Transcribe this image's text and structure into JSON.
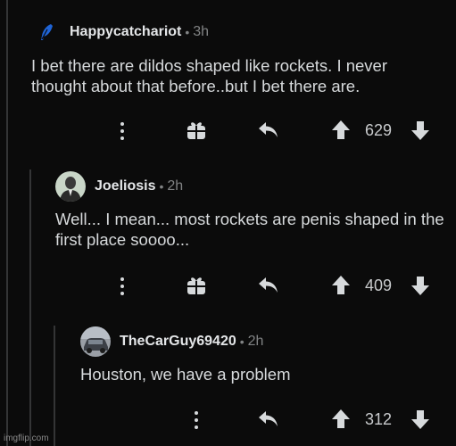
{
  "comments": [
    {
      "username": "Happycatchariot",
      "age": "3h",
      "text": "I bet there are dildos shaped like rockets. I never thought about that before..but I bet there are.",
      "score": "629",
      "avatar_icon": "feather-icon",
      "has_award": true
    },
    {
      "username": "Joeliosis",
      "age": "2h",
      "text": "Well... I mean... most rockets are penis shaped in the first place soooo...",
      "score": "409",
      "avatar_icon": "suited-man-avatar",
      "has_award": true
    },
    {
      "username": "TheCarGuy69420",
      "age": "2h",
      "text": "Houston, we have a problem",
      "score": "312",
      "avatar_icon": "car-avatar",
      "has_award": false
    }
  ],
  "separator": "•",
  "watermark": "imgflip.com",
  "colors": {
    "background": "#0b0b0b",
    "text": "#d7dadc",
    "muted": "#818384",
    "feather": "#1f64d6"
  }
}
